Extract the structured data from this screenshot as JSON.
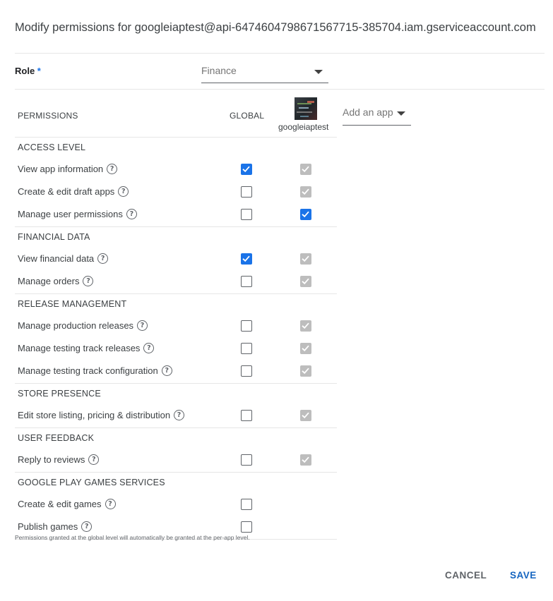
{
  "dialog": {
    "title": "Modify permissions for googleiaptest@api-6474604798671567715-385704.iam.gserviceaccount.com"
  },
  "role": {
    "label": "Role",
    "required_mark": "*",
    "selected": "Finance"
  },
  "table": {
    "header_permissions": "PERMISSIONS",
    "header_global": "GLOBAL",
    "app_name": "googleiaptest",
    "add_app_placeholder": "Add an app"
  },
  "sections": [
    {
      "name": "ACCESS LEVEL",
      "permissions": [
        {
          "label": "View app information",
          "global": true,
          "app": true,
          "app_disabled": true
        },
        {
          "label": "Create & edit draft apps",
          "global": false,
          "app": true,
          "app_disabled": true
        },
        {
          "label": "Manage user permissions",
          "global": false,
          "app": true,
          "app_disabled": false
        }
      ]
    },
    {
      "name": "FINANCIAL DATA",
      "permissions": [
        {
          "label": "View financial data",
          "global": true,
          "app": true,
          "app_disabled": true
        },
        {
          "label": "Manage orders",
          "global": false,
          "app": true,
          "app_disabled": true
        }
      ]
    },
    {
      "name": "RELEASE MANAGEMENT",
      "permissions": [
        {
          "label": "Manage production releases",
          "global": false,
          "app": true,
          "app_disabled": true
        },
        {
          "label": "Manage testing track releases",
          "global": false,
          "app": true,
          "app_disabled": true
        },
        {
          "label": "Manage testing track configuration",
          "global": false,
          "app": true,
          "app_disabled": true
        }
      ]
    },
    {
      "name": "STORE PRESENCE",
      "permissions": [
        {
          "label": "Edit store listing, pricing & distribution",
          "global": false,
          "app": true,
          "app_disabled": true
        }
      ]
    },
    {
      "name": "USER FEEDBACK",
      "permissions": [
        {
          "label": "Reply to reviews",
          "global": false,
          "app": true,
          "app_disabled": true
        }
      ]
    },
    {
      "name": "GOOGLE PLAY GAMES SERVICES",
      "permissions": [
        {
          "label": "Create & edit games",
          "global": false,
          "app": null,
          "app_disabled": false
        },
        {
          "label": "Publish games",
          "global": false,
          "app": null,
          "app_disabled": false
        }
      ]
    }
  ],
  "footnote": "Permissions granted at the global level will automatically be granted at the per-app level.",
  "actions": {
    "cancel": "CANCEL",
    "save": "SAVE"
  },
  "colors": {
    "accent": "#1a73e8",
    "save_text": "#1565c0",
    "disabled_check": "#bdbdbd"
  },
  "icons": {
    "help": "help-circle-icon",
    "dropdown": "caret-down-icon",
    "check": "check-icon"
  }
}
